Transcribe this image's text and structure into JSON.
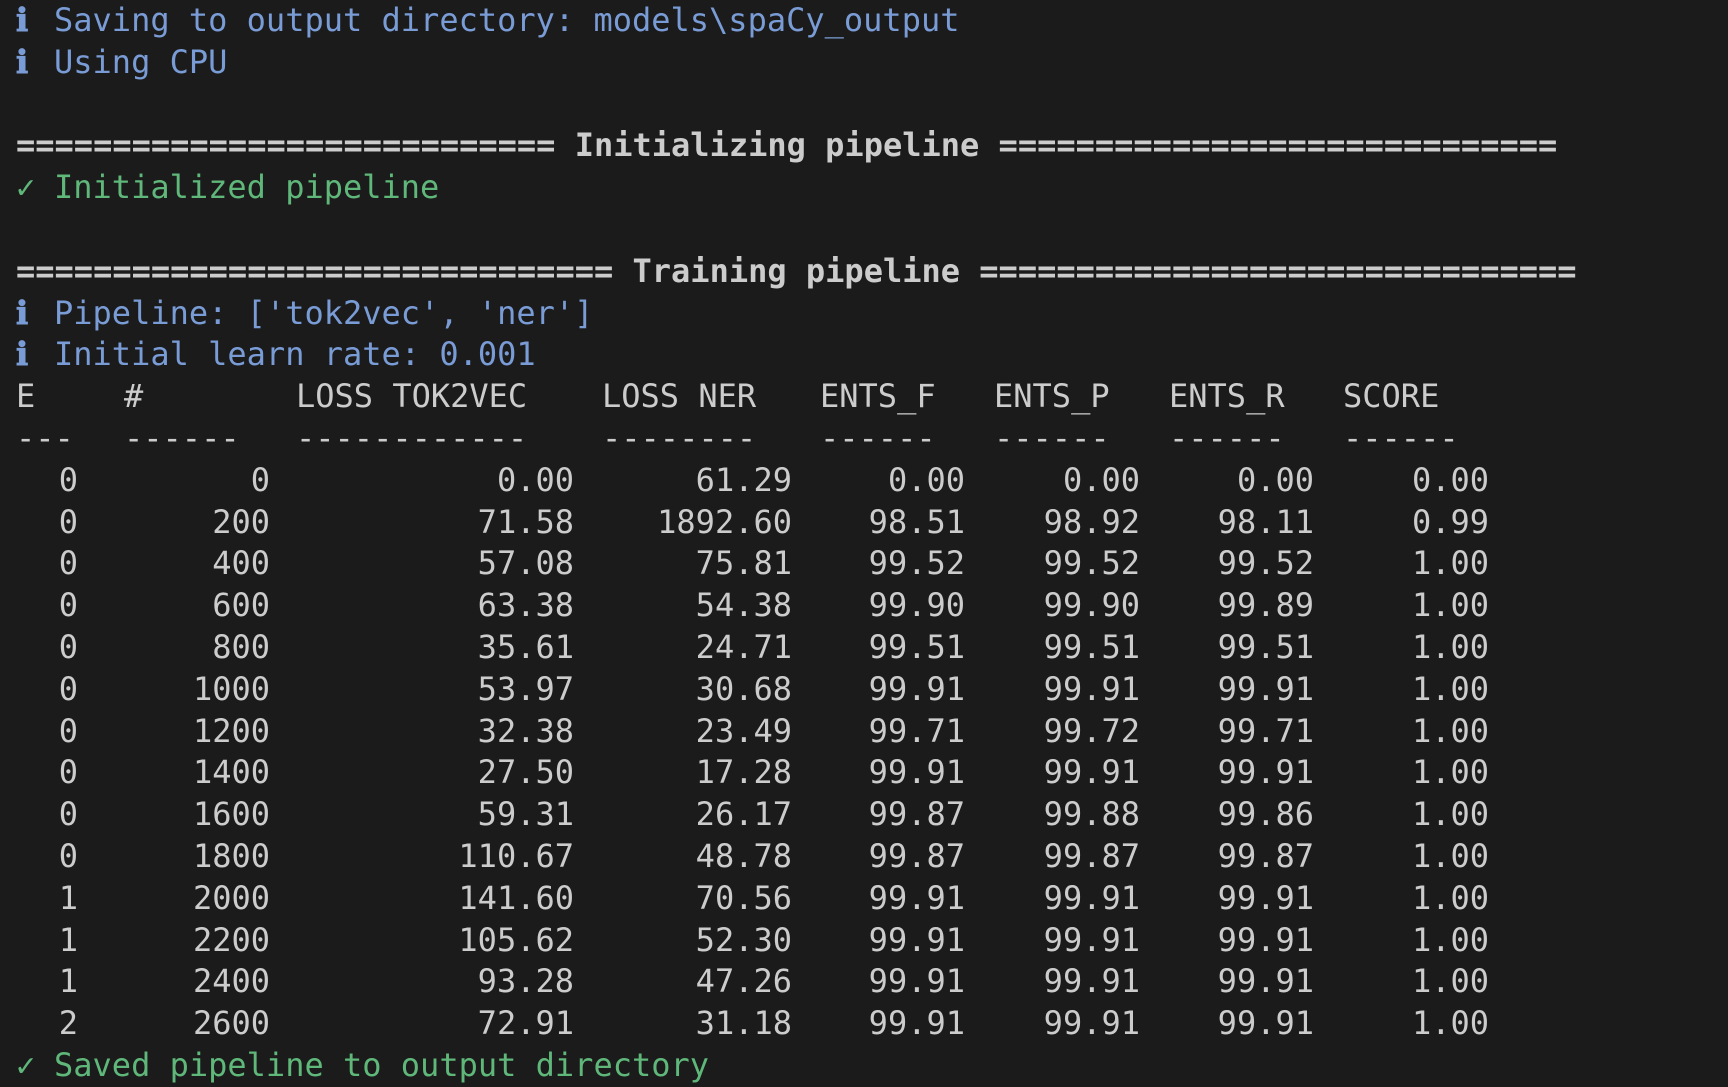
{
  "colors": {
    "background": "#1b1b1b",
    "info": "#7a9cd6",
    "success": "#5fb77a",
    "text": "#cccccc"
  },
  "icons": {
    "info": "ℹ",
    "success": "✓"
  },
  "lines": {
    "saving": "Saving to output directory: models\\spaCy_output",
    "device": "Using CPU",
    "init_banner": "============================ Initializing pipeline =============================",
    "init_done": "Initialized pipeline",
    "train_banner": "=============================== Training pipeline ===============================",
    "pipeline": "Pipeline: ['tok2vec', 'ner']",
    "learn_rate": "Initial learn rate: 0.001",
    "saved": "Saved pipeline to output directory"
  },
  "table": {
    "headers": [
      "E",
      "#",
      "LOSS TOK2VEC",
      "LOSS NER",
      "ENTS_F",
      "ENTS_P",
      "ENTS_R",
      "SCORE"
    ],
    "separators": [
      "---",
      "------",
      "------------",
      "--------",
      "------",
      "------",
      "------",
      "------"
    ],
    "rows": [
      [
        "0",
        "0",
        "0.00",
        "61.29",
        "0.00",
        "0.00",
        "0.00",
        "0.00"
      ],
      [
        "0",
        "200",
        "71.58",
        "1892.60",
        "98.51",
        "98.92",
        "98.11",
        "0.99"
      ],
      [
        "0",
        "400",
        "57.08",
        "75.81",
        "99.52",
        "99.52",
        "99.52",
        "1.00"
      ],
      [
        "0",
        "600",
        "63.38",
        "54.38",
        "99.90",
        "99.90",
        "99.89",
        "1.00"
      ],
      [
        "0",
        "800",
        "35.61",
        "24.71",
        "99.51",
        "99.51",
        "99.51",
        "1.00"
      ],
      [
        "0",
        "1000",
        "53.97",
        "30.68",
        "99.91",
        "99.91",
        "99.91",
        "1.00"
      ],
      [
        "0",
        "1200",
        "32.38",
        "23.49",
        "99.71",
        "99.72",
        "99.71",
        "1.00"
      ],
      [
        "0",
        "1400",
        "27.50",
        "17.28",
        "99.91",
        "99.91",
        "99.91",
        "1.00"
      ],
      [
        "0",
        "1600",
        "59.31",
        "26.17",
        "99.87",
        "99.88",
        "99.86",
        "1.00"
      ],
      [
        "0",
        "1800",
        "110.67",
        "48.78",
        "99.87",
        "99.87",
        "99.87",
        "1.00"
      ],
      [
        "1",
        "2000",
        "141.60",
        "70.56",
        "99.91",
        "99.91",
        "99.91",
        "1.00"
      ],
      [
        "1",
        "2200",
        "105.62",
        "52.30",
        "99.91",
        "99.91",
        "99.91",
        "1.00"
      ],
      [
        "1",
        "2400",
        "93.28",
        "47.26",
        "99.91",
        "99.91",
        "99.91",
        "1.00"
      ],
      [
        "2",
        "2600",
        "72.91",
        "31.18",
        "99.91",
        "99.91",
        "99.91",
        "1.00"
      ]
    ]
  }
}
